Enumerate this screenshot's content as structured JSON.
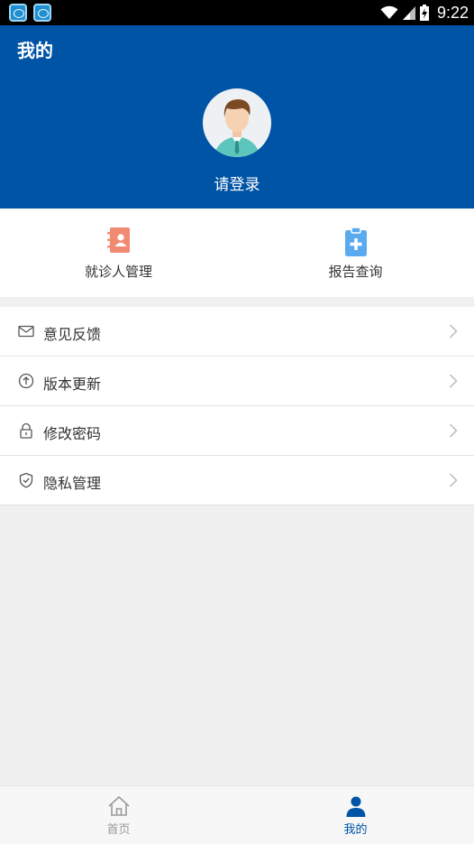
{
  "status_bar": {
    "time": "9:22"
  },
  "header": {
    "title": "我的",
    "login_text": "请登录"
  },
  "quick_actions": [
    {
      "label": "就诊人管理",
      "icon": "contact-book-icon",
      "color": "#f08a73"
    },
    {
      "label": "报告查询",
      "icon": "clipboard-plus-icon",
      "color": "#5aaaf0"
    }
  ],
  "menu": [
    {
      "label": "意见反馈",
      "icon": "envelope-icon"
    },
    {
      "label": "版本更新",
      "icon": "arrow-up-circle-icon"
    },
    {
      "label": "修改密码",
      "icon": "lock-icon"
    },
    {
      "label": "隐私管理",
      "icon": "shield-icon"
    }
  ],
  "bottom_nav": [
    {
      "label": "首页",
      "icon": "home-icon",
      "active": false
    },
    {
      "label": "我的",
      "icon": "user-icon",
      "active": true
    }
  ],
  "colors": {
    "primary": "#0054a6",
    "inactive": "#999999",
    "background": "#f0f0f0"
  }
}
